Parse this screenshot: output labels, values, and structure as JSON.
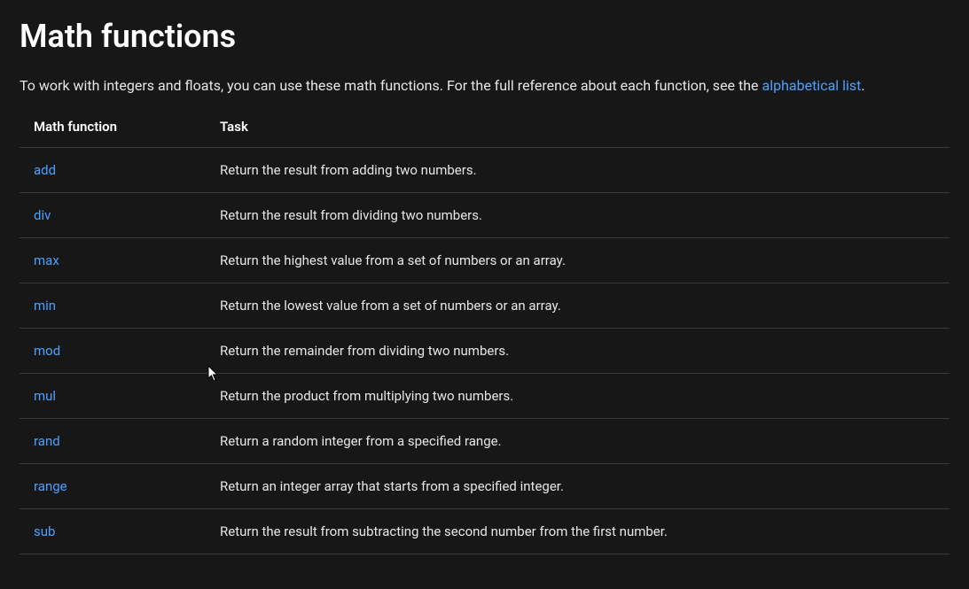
{
  "page": {
    "title": "Math functions",
    "intro_prefix": "To work with integers and floats, you can use these math functions. For the full reference about each function, see the ",
    "intro_link_text": "alphabetical list",
    "intro_suffix": "."
  },
  "table": {
    "headers": {
      "col1": "Math function",
      "col2": "Task"
    },
    "rows": [
      {
        "name": "add",
        "task": "Return the result from adding two numbers."
      },
      {
        "name": "div",
        "task": "Return the result from dividing two numbers."
      },
      {
        "name": "max",
        "task": "Return the highest value from a set of numbers or an array."
      },
      {
        "name": "min",
        "task": "Return the lowest value from a set of numbers or an array."
      },
      {
        "name": "mod",
        "task": "Return the remainder from dividing two numbers."
      },
      {
        "name": "mul",
        "task": "Return the product from multiplying two numbers."
      },
      {
        "name": "rand",
        "task": "Return a random integer from a specified range."
      },
      {
        "name": "range",
        "task": "Return an integer array that starts from a specified integer."
      },
      {
        "name": "sub",
        "task": "Return the result from subtracting the second number from the first number."
      }
    ]
  }
}
